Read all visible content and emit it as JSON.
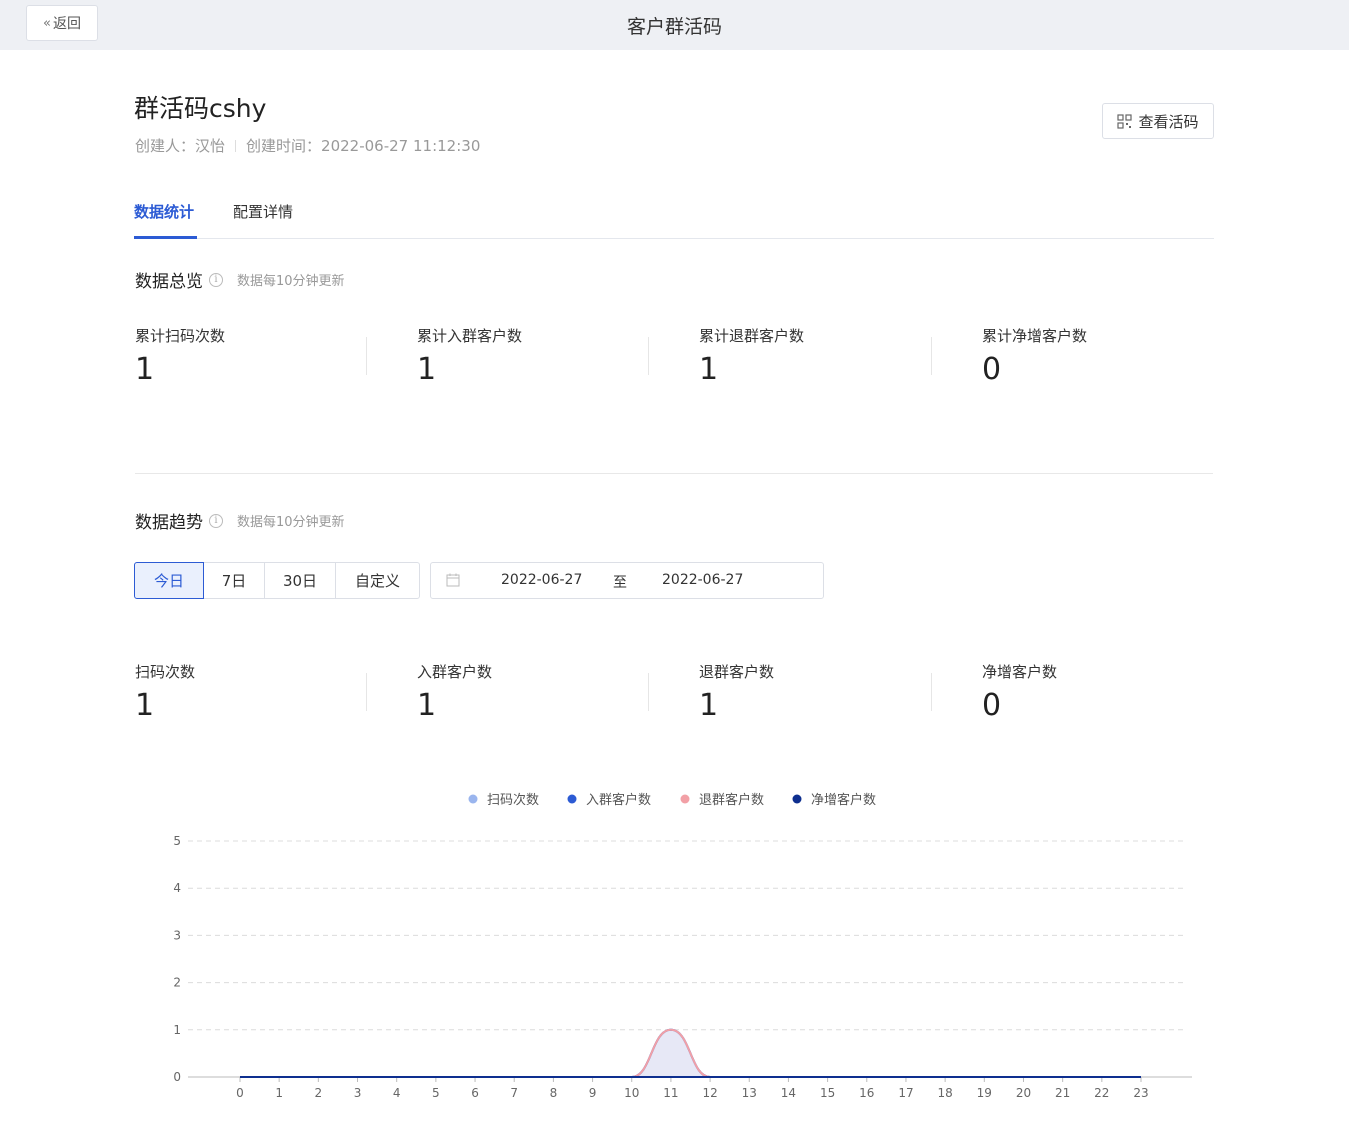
{
  "header": {
    "back_label": "返回",
    "title": "客户群活码"
  },
  "detail": {
    "name": "群活码cshy",
    "creator_label": "创建人：",
    "creator": "汉怡",
    "created_label": "创建时间：",
    "created_at": "2022-06-27 11:12:30",
    "view_code_label": "查看活码"
  },
  "tabs": [
    {
      "label": "数据统计"
    },
    {
      "label": "配置详情"
    }
  ],
  "overview": {
    "title": "数据总览",
    "note": "数据每10分钟更新",
    "stats": [
      {
        "label": "累计扫码次数",
        "value": "1"
      },
      {
        "label": "累计入群客户数",
        "value": "1"
      },
      {
        "label": "累计退群客户数",
        "value": "1"
      },
      {
        "label": "累计净增客户数",
        "value": "0"
      }
    ]
  },
  "trend": {
    "title": "数据趋势",
    "note": "数据每10分钟更新",
    "ranges": [
      {
        "label": "今日"
      },
      {
        "label": "7日"
      },
      {
        "label": "30日"
      },
      {
        "label": "自定义"
      }
    ],
    "start_date": "2022-06-27",
    "to_label": "至",
    "end_date": "2022-06-27",
    "stats": [
      {
        "label": "扫码次数",
        "value": "1"
      },
      {
        "label": "入群客户数",
        "value": "1"
      },
      {
        "label": "退群客户数",
        "value": "1"
      },
      {
        "label": "净增客户数",
        "value": "0"
      }
    ]
  },
  "colors": {
    "accent": "#2c5bd4",
    "series_scan": "#9ab5ee",
    "series_join": "#2c5bd4",
    "series_leave": "#f2a0a6",
    "series_net": "#0e2f8f"
  },
  "chart_data": {
    "type": "line",
    "x": [
      0,
      1,
      2,
      3,
      4,
      5,
      6,
      7,
      8,
      9,
      10,
      11,
      12,
      13,
      14,
      15,
      16,
      17,
      18,
      19,
      20,
      21,
      22,
      23
    ],
    "ylim": [
      0,
      5
    ],
    "yticks": [
      0,
      1,
      2,
      3,
      4,
      5
    ],
    "series": [
      {
        "name": "扫码次数",
        "color": "#9ab5ee",
        "values": [
          0,
          0,
          0,
          0,
          0,
          0,
          0,
          0,
          0,
          0,
          0,
          1,
          0,
          0,
          0,
          0,
          0,
          0,
          0,
          0,
          0,
          0,
          0,
          0
        ]
      },
      {
        "name": "入群客户数",
        "color": "#2c5bd4",
        "values": [
          0,
          0,
          0,
          0,
          0,
          0,
          0,
          0,
          0,
          0,
          0,
          1,
          0,
          0,
          0,
          0,
          0,
          0,
          0,
          0,
          0,
          0,
          0,
          0
        ]
      },
      {
        "name": "退群客户数",
        "color": "#f2a0a6",
        "values": [
          0,
          0,
          0,
          0,
          0,
          0,
          0,
          0,
          0,
          0,
          0,
          1,
          0,
          0,
          0,
          0,
          0,
          0,
          0,
          0,
          0,
          0,
          0,
          0
        ]
      },
      {
        "name": "净增客户数",
        "color": "#0e2f8f",
        "values": [
          0,
          0,
          0,
          0,
          0,
          0,
          0,
          0,
          0,
          0,
          0,
          0,
          0,
          0,
          0,
          0,
          0,
          0,
          0,
          0,
          0,
          0,
          0,
          0
        ]
      }
    ]
  }
}
